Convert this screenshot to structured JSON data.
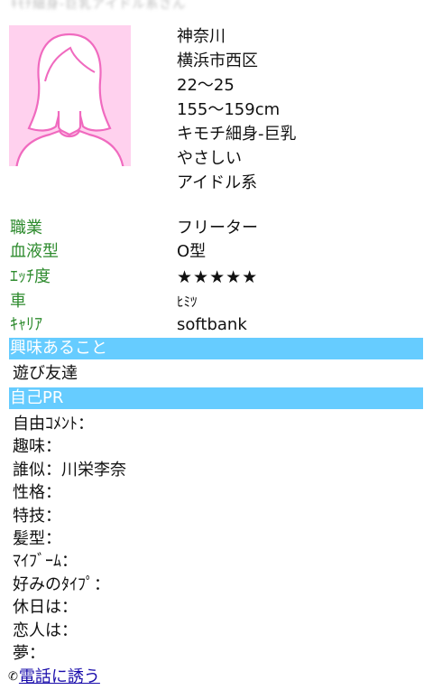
{
  "profile": {
    "name_blurred": "ｷﾓﾁ細身-巨乳アイドル系さん",
    "basic": [
      "神奈川",
      "横浜市西区",
      "22〜25",
      "155〜159cm",
      "キモチ細身-巨乳",
      "やさしい",
      "アイドル系"
    ],
    "details": [
      {
        "label": "職業",
        "value": "フリーター"
      },
      {
        "label": "血液型",
        "value": "O型"
      },
      {
        "label": "ｴｯﾁ度",
        "value": "★★★★★"
      },
      {
        "label": "車",
        "value": "ﾋﾐﾂ"
      },
      {
        "label": "ｷｬﾘｱ",
        "value": "softbank"
      }
    ]
  },
  "interest": {
    "header": "興味あること",
    "value": "遊び友達"
  },
  "pr": {
    "header": "自己PR",
    "items": [
      "自由ｺﾒﾝﾄ：",
      "趣味：",
      "誰似：川栄李奈",
      "性格：",
      "特技：",
      "髪型：",
      "ﾏｲﾌﾞｰﾑ：",
      "好みのﾀｲﾌﾟ：",
      "休日は：",
      "恋人は：",
      "夢："
    ]
  },
  "call": {
    "icon": "phone-icon",
    "label": "電話に誘う"
  },
  "colors": {
    "label_green": "#2e8b2e",
    "section_blue": "#66ccff",
    "avatar_bg": "#ffd1ee",
    "avatar_figure": "#ffffff",
    "avatar_outline": "#f06abf",
    "link": "#1a0dab"
  }
}
